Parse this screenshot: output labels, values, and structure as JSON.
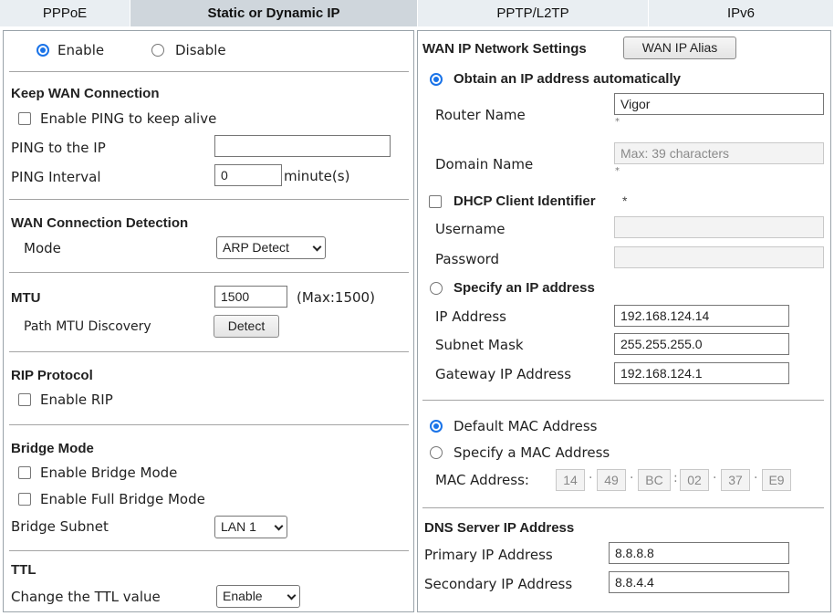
{
  "tabs": [
    {
      "label": "PPPoE"
    },
    {
      "label": "Static or Dynamic IP"
    },
    {
      "label": "PPTP/L2TP"
    },
    {
      "label": "IPv6"
    }
  ],
  "left": {
    "enable_label": "Enable",
    "disable_label": "Disable",
    "keep_wan": {
      "title": "Keep WAN Connection",
      "ping_keep_alive_label": "Enable PING to keep alive",
      "ping_ip_label": "PING to the IP",
      "ping_ip_value": "",
      "ping_interval_label": "PING Interval",
      "ping_interval_value": "0",
      "ping_interval_unit": "minute(s)"
    },
    "detection": {
      "title": "WAN Connection Detection",
      "mode_label": "Mode",
      "mode_value": "ARP Detect"
    },
    "mtu": {
      "title": "MTU",
      "value": "1500",
      "max_text": "(Max:1500)",
      "path_mtu_label": "Path MTU Discovery",
      "detect_button": "Detect"
    },
    "rip": {
      "title": "RIP Protocol",
      "enable_label": "Enable RIP"
    },
    "bridge": {
      "title": "Bridge Mode",
      "enable_bridge_label": "Enable Bridge Mode",
      "enable_full_bridge_label": "Enable Full Bridge Mode",
      "subnet_label": "Bridge Subnet",
      "subnet_value": "LAN 1"
    },
    "ttl": {
      "title": "TTL",
      "change_label": "Change the TTL value",
      "change_value": "Enable"
    }
  },
  "right": {
    "wan_settings_title": "WAN IP Network Settings",
    "wan_alias_button": "WAN IP Alias",
    "obtain_auto_label": "Obtain an IP address automatically",
    "router_name_label": "Router Name",
    "router_name_value": "Vigor",
    "domain_name_label": "Domain Name",
    "domain_name_placeholder": "Max: 39 characters",
    "star": "*",
    "dhcp_client_label": "DHCP Client Identifier",
    "username_label": "Username",
    "password_label": "Password",
    "specify_ip_label": "Specify an IP address",
    "ip_address_label": "IP Address",
    "ip_address_value": "192.168.124.14",
    "subnet_mask_label": "Subnet Mask",
    "subnet_mask_value": "255.255.255.0",
    "gateway_label": "Gateway IP Address",
    "gateway_value": "192.168.124.1",
    "default_mac_label": "Default MAC Address",
    "specify_mac_label": "Specify a MAC Address",
    "mac_address_label": "MAC Address:",
    "mac_octets": [
      "14",
      "49",
      "BC",
      "02",
      "37",
      "E9"
    ],
    "dns_title": "DNS Server IP Address",
    "primary_dns_label": "Primary IP Address",
    "primary_dns_value": "8.8.8.8",
    "secondary_dns_label": "Secondary IP Address",
    "secondary_dns_value": "8.8.4.4"
  },
  "colors": {
    "accent": "#1a73e8",
    "tab_bg": "#e9eef2",
    "tab_active_bg": "#cfd6dc"
  }
}
